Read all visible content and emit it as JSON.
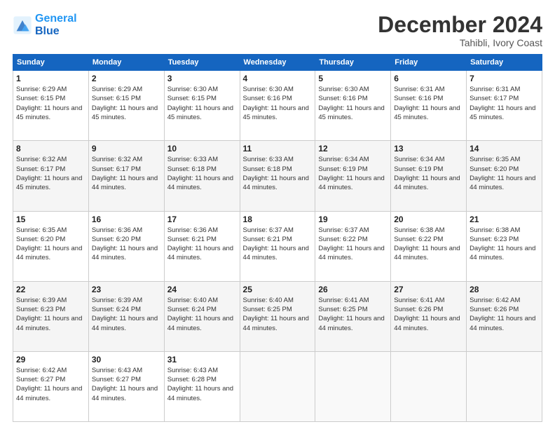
{
  "header": {
    "logo_line1": "General",
    "logo_line2": "Blue",
    "month": "December 2024",
    "location": "Tahibli, Ivory Coast"
  },
  "weekdays": [
    "Sunday",
    "Monday",
    "Tuesday",
    "Wednesday",
    "Thursday",
    "Friday",
    "Saturday"
  ],
  "weeks": [
    [
      {
        "day": "1",
        "sunrise": "6:29 AM",
        "sunset": "6:15 PM",
        "daylight": "11 hours and 45 minutes."
      },
      {
        "day": "2",
        "sunrise": "6:29 AM",
        "sunset": "6:15 PM",
        "daylight": "11 hours and 45 minutes."
      },
      {
        "day": "3",
        "sunrise": "6:30 AM",
        "sunset": "6:15 PM",
        "daylight": "11 hours and 45 minutes."
      },
      {
        "day": "4",
        "sunrise": "6:30 AM",
        "sunset": "6:16 PM",
        "daylight": "11 hours and 45 minutes."
      },
      {
        "day": "5",
        "sunrise": "6:30 AM",
        "sunset": "6:16 PM",
        "daylight": "11 hours and 45 minutes."
      },
      {
        "day": "6",
        "sunrise": "6:31 AM",
        "sunset": "6:16 PM",
        "daylight": "11 hours and 45 minutes."
      },
      {
        "day": "7",
        "sunrise": "6:31 AM",
        "sunset": "6:17 PM",
        "daylight": "11 hours and 45 minutes."
      }
    ],
    [
      {
        "day": "8",
        "sunrise": "6:32 AM",
        "sunset": "6:17 PM",
        "daylight": "11 hours and 45 minutes."
      },
      {
        "day": "9",
        "sunrise": "6:32 AM",
        "sunset": "6:17 PM",
        "daylight": "11 hours and 44 minutes."
      },
      {
        "day": "10",
        "sunrise": "6:33 AM",
        "sunset": "6:18 PM",
        "daylight": "11 hours and 44 minutes."
      },
      {
        "day": "11",
        "sunrise": "6:33 AM",
        "sunset": "6:18 PM",
        "daylight": "11 hours and 44 minutes."
      },
      {
        "day": "12",
        "sunrise": "6:34 AM",
        "sunset": "6:19 PM",
        "daylight": "11 hours and 44 minutes."
      },
      {
        "day": "13",
        "sunrise": "6:34 AM",
        "sunset": "6:19 PM",
        "daylight": "11 hours and 44 minutes."
      },
      {
        "day": "14",
        "sunrise": "6:35 AM",
        "sunset": "6:20 PM",
        "daylight": "11 hours and 44 minutes."
      }
    ],
    [
      {
        "day": "15",
        "sunrise": "6:35 AM",
        "sunset": "6:20 PM",
        "daylight": "11 hours and 44 minutes."
      },
      {
        "day": "16",
        "sunrise": "6:36 AM",
        "sunset": "6:20 PM",
        "daylight": "11 hours and 44 minutes."
      },
      {
        "day": "17",
        "sunrise": "6:36 AM",
        "sunset": "6:21 PM",
        "daylight": "11 hours and 44 minutes."
      },
      {
        "day": "18",
        "sunrise": "6:37 AM",
        "sunset": "6:21 PM",
        "daylight": "11 hours and 44 minutes."
      },
      {
        "day": "19",
        "sunrise": "6:37 AM",
        "sunset": "6:22 PM",
        "daylight": "11 hours and 44 minutes."
      },
      {
        "day": "20",
        "sunrise": "6:38 AM",
        "sunset": "6:22 PM",
        "daylight": "11 hours and 44 minutes."
      },
      {
        "day": "21",
        "sunrise": "6:38 AM",
        "sunset": "6:23 PM",
        "daylight": "11 hours and 44 minutes."
      }
    ],
    [
      {
        "day": "22",
        "sunrise": "6:39 AM",
        "sunset": "6:23 PM",
        "daylight": "11 hours and 44 minutes."
      },
      {
        "day": "23",
        "sunrise": "6:39 AM",
        "sunset": "6:24 PM",
        "daylight": "11 hours and 44 minutes."
      },
      {
        "day": "24",
        "sunrise": "6:40 AM",
        "sunset": "6:24 PM",
        "daylight": "11 hours and 44 minutes."
      },
      {
        "day": "25",
        "sunrise": "6:40 AM",
        "sunset": "6:25 PM",
        "daylight": "11 hours and 44 minutes."
      },
      {
        "day": "26",
        "sunrise": "6:41 AM",
        "sunset": "6:25 PM",
        "daylight": "11 hours and 44 minutes."
      },
      {
        "day": "27",
        "sunrise": "6:41 AM",
        "sunset": "6:26 PM",
        "daylight": "11 hours and 44 minutes."
      },
      {
        "day": "28",
        "sunrise": "6:42 AM",
        "sunset": "6:26 PM",
        "daylight": "11 hours and 44 minutes."
      }
    ],
    [
      {
        "day": "29",
        "sunrise": "6:42 AM",
        "sunset": "6:27 PM",
        "daylight": "11 hours and 44 minutes."
      },
      {
        "day": "30",
        "sunrise": "6:43 AM",
        "sunset": "6:27 PM",
        "daylight": "11 hours and 44 minutes."
      },
      {
        "day": "31",
        "sunrise": "6:43 AM",
        "sunset": "6:28 PM",
        "daylight": "11 hours and 44 minutes."
      },
      null,
      null,
      null,
      null
    ]
  ]
}
